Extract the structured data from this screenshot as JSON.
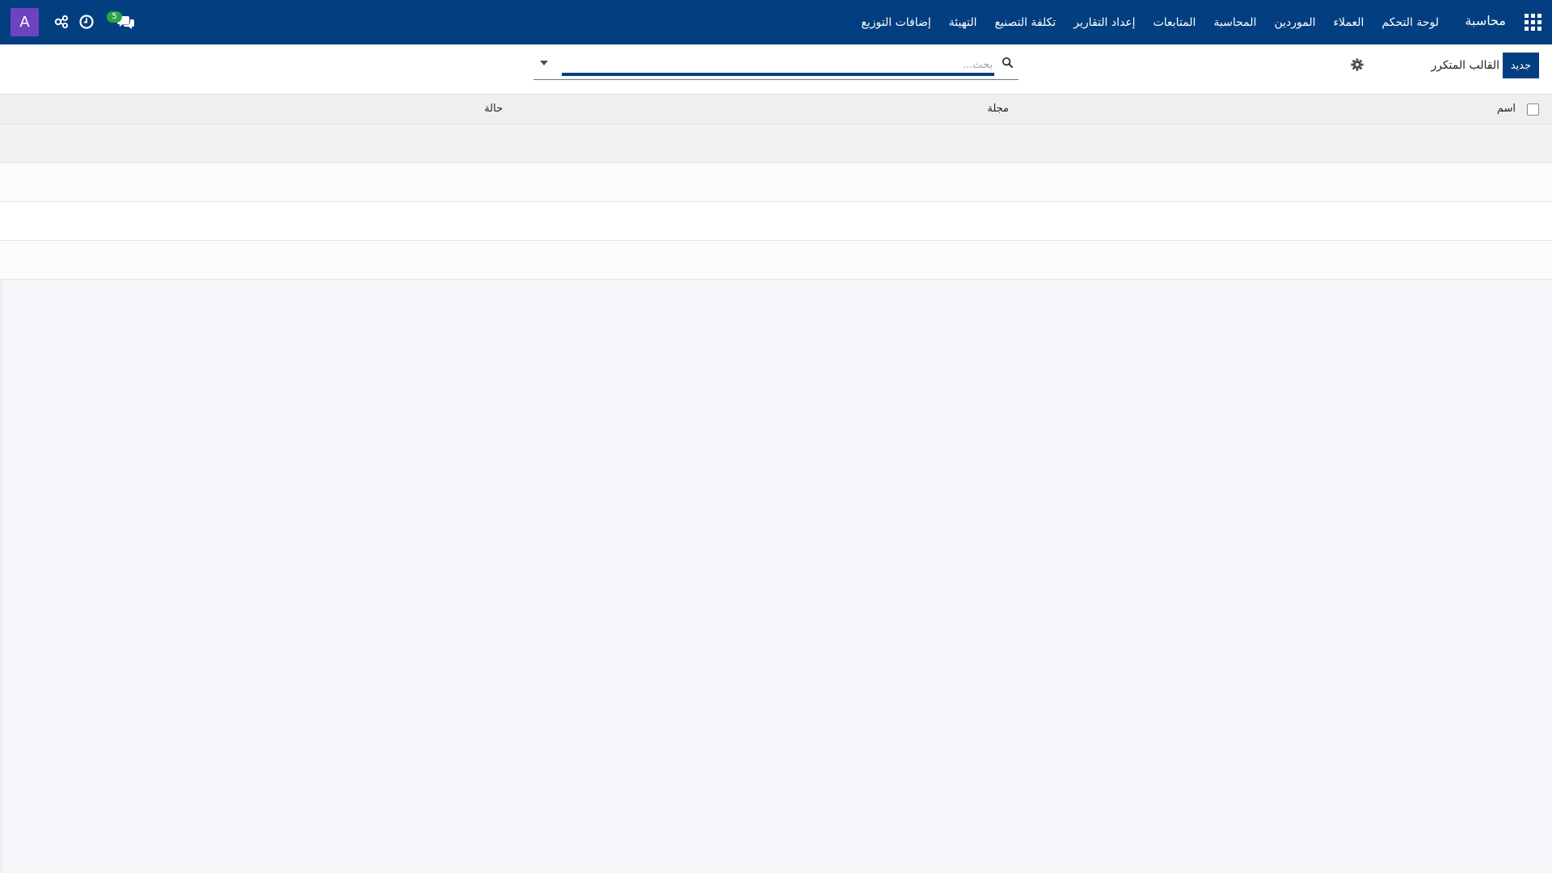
{
  "navbar": {
    "brand": "محاسبة",
    "menu": [
      "لوحة التحكم",
      "العملاء",
      "الموردين",
      "المحاسبة",
      "المتابعات",
      "إعداد التقارير",
      "تكلفة التصنيع",
      "التهيئة",
      "إضافات التوزيع"
    ],
    "messages_badge": "5",
    "avatar_letter": "A",
    "colors": {
      "bar": "#033f80",
      "avatar": "#6f42c1",
      "badge": "#28a745"
    }
  },
  "control_panel": {
    "new_button": "جديد",
    "breadcrumb": "القالب المتكرر",
    "search_placeholder": "بحث..."
  },
  "list": {
    "columns": [
      "اسم",
      "مجلة",
      "حالة"
    ],
    "rows": []
  }
}
